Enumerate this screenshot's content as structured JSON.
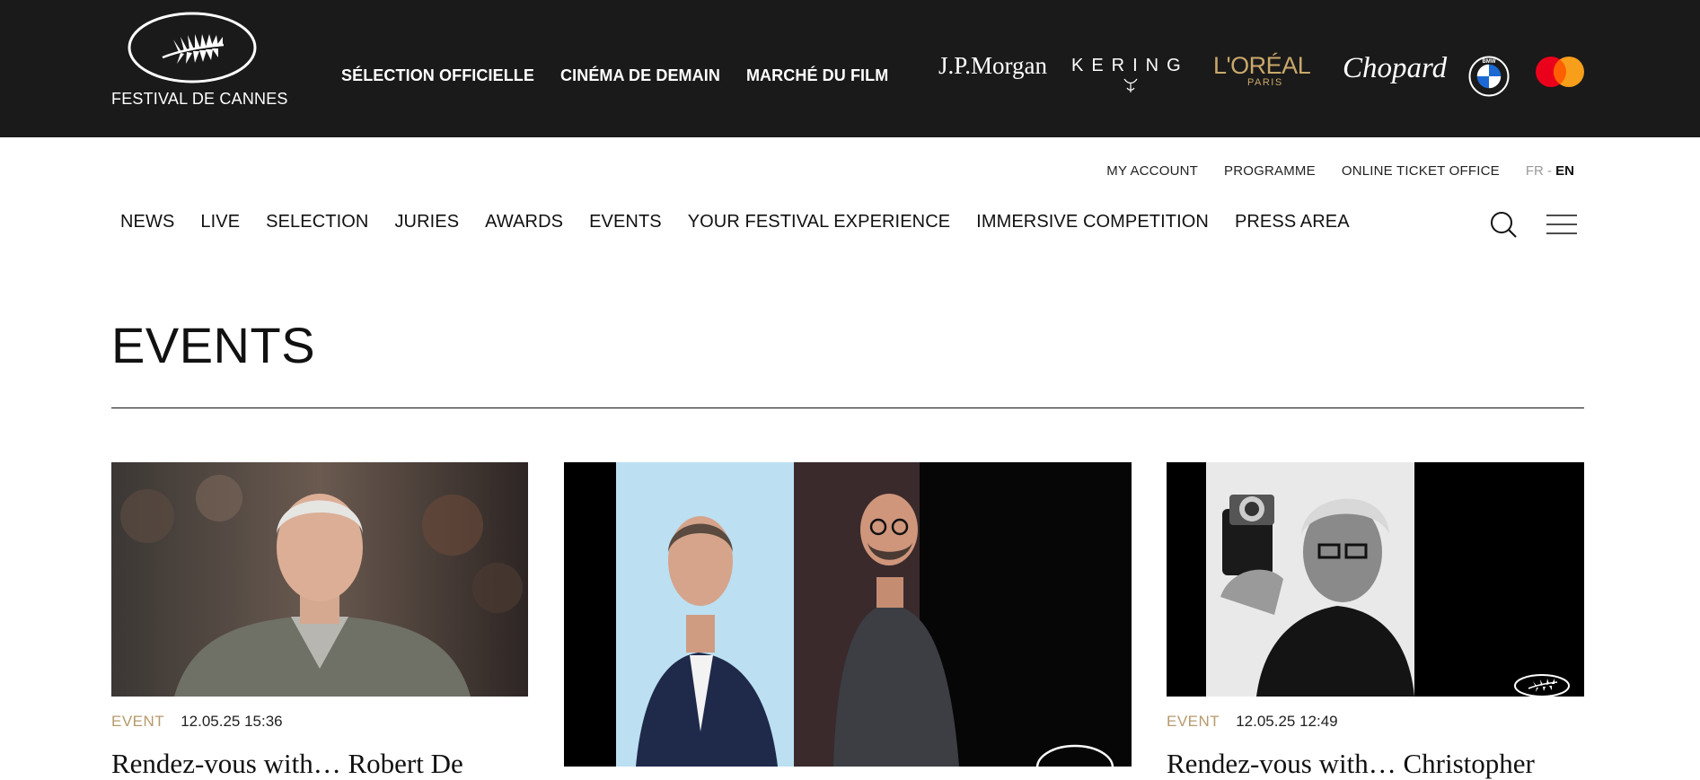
{
  "header": {
    "logo_text": "FESTIVAL DE CANNES",
    "top_nav": [
      "SÉLECTION OFFICIELLE",
      "CINÉMA DE DEMAIN",
      "MARCHÉ DU FILM"
    ],
    "sponsors": {
      "jpmorgan": "J.P.Morgan",
      "kering": "KERING",
      "loreal": "L'ORÉAL",
      "loreal_sub": "PARIS",
      "chopard": "Chopard",
      "bmw_letters": "BMW"
    }
  },
  "utility_nav": {
    "my_account": "MY ACCOUNT",
    "programme": "PROGRAMME",
    "ticket_office": "ONLINE TICKET OFFICE",
    "lang_fr": "FR",
    "lang_sep": " - ",
    "lang_en": "EN"
  },
  "main_nav": [
    "NEWS",
    "LIVE",
    "SELECTION",
    "JURIES",
    "AWARDS",
    "EVENTS",
    "YOUR FESTIVAL EXPERIENCE",
    "IMMERSIVE COMPETITION",
    "PRESS AREA"
  ],
  "page": {
    "title": "EVENTS"
  },
  "cards": [
    {
      "category": "EVENT",
      "date": "12.05.25 15:36",
      "title": "Rendez-vous with… Robert De"
    },
    {
      "category": "",
      "date": "",
      "title": ""
    },
    {
      "category": "EVENT",
      "date": "12.05.25 12:49",
      "title": "Rendez-vous with… Christopher"
    }
  ],
  "icons": {
    "search": "search-icon",
    "menu": "hamburger-menu-icon",
    "palm": "palme-d-or-icon"
  },
  "colors": {
    "topbar": "#1a1a1a",
    "gold": "#b59a6c",
    "loreal_gold": "#c9a86b"
  }
}
